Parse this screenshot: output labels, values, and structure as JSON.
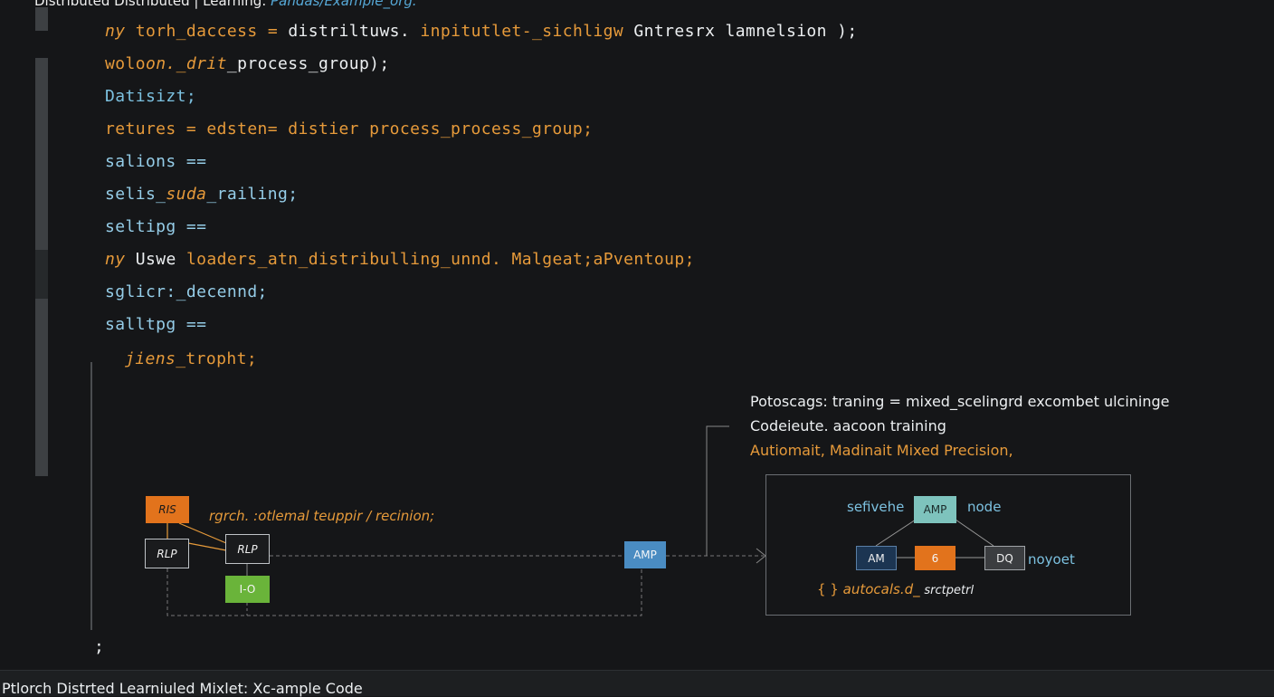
{
  "window": {
    "title": "Distributed Distributed | Learning: ",
    "title_accent": "Pandas/Example_org:"
  },
  "code": {
    "line1": {
      "kw": "ny",
      "a": "torh_daccess =",
      "b": "distriltuws.",
      "c": "inpitutlet-_sichligw",
      "d": "Gntresrx lamnelsion  );"
    },
    "line2": {
      "a": "wolo",
      "b": "on._drit",
      "c": "_process_group);"
    },
    "line3": {
      "a": "Datisizt;"
    },
    "line4": {
      "a": "retures =  edsten=  distier process_process_group;"
    },
    "line5": {
      "a": "salions =="
    },
    "line6": {
      "a": "selis_",
      "b": "suda",
      "c": "_railing;"
    },
    "line7": {
      "a": "seltipg =="
    },
    "line8": {
      "kw": "ny",
      "a": "Uswe",
      "b": "loaders_atn_distribulling_unnd.",
      "c": "Malgeat;",
      "d": "aPventoup;"
    },
    "line9": {
      "a": "sglicr:_decennd;"
    },
    "line10": {
      "a": "salltpg =="
    },
    "line11": {
      "a": "jiens",
      "b": "_tropht;"
    },
    "closing": ";"
  },
  "notes": {
    "line1": "Potoscags: traning = mixed_scelingrd excombet ulcininge",
    "line2": "Codeieute. aacoon training",
    "line3": "Autiomait, Madinait Mixed Precision,"
  },
  "diagram": {
    "node_top": "RIS",
    "node_left": "RLP",
    "node_mid": "RLP",
    "node_green": "I-O",
    "label_top": "rgrch. :otlemal teuppir / recinion;",
    "node_amp": "AMP",
    "inner_amp": "AMP",
    "inner_left_label": "sefivehe",
    "inner_right_label": "node",
    "inner_am": "AM",
    "inner_six": "6",
    "inner_dq": "DQ",
    "inner_noyoet": "noyoet",
    "inner_auto_prefix": "{ }",
    "inner_auto": "autocals.d_",
    "inner_auto_tail": "srctpetrl"
  },
  "footer": {
    "text": "Ptlorch Distrted Learniuled Mixlet: Xc-ample Code"
  },
  "colors": {
    "orange": "#e69a3a",
    "blue": "#7cc1e0",
    "amp_blue": "#4a8cc2",
    "teal": "#7ec3bd",
    "green": "#6ab43a",
    "node_orange": "#e2731c"
  }
}
